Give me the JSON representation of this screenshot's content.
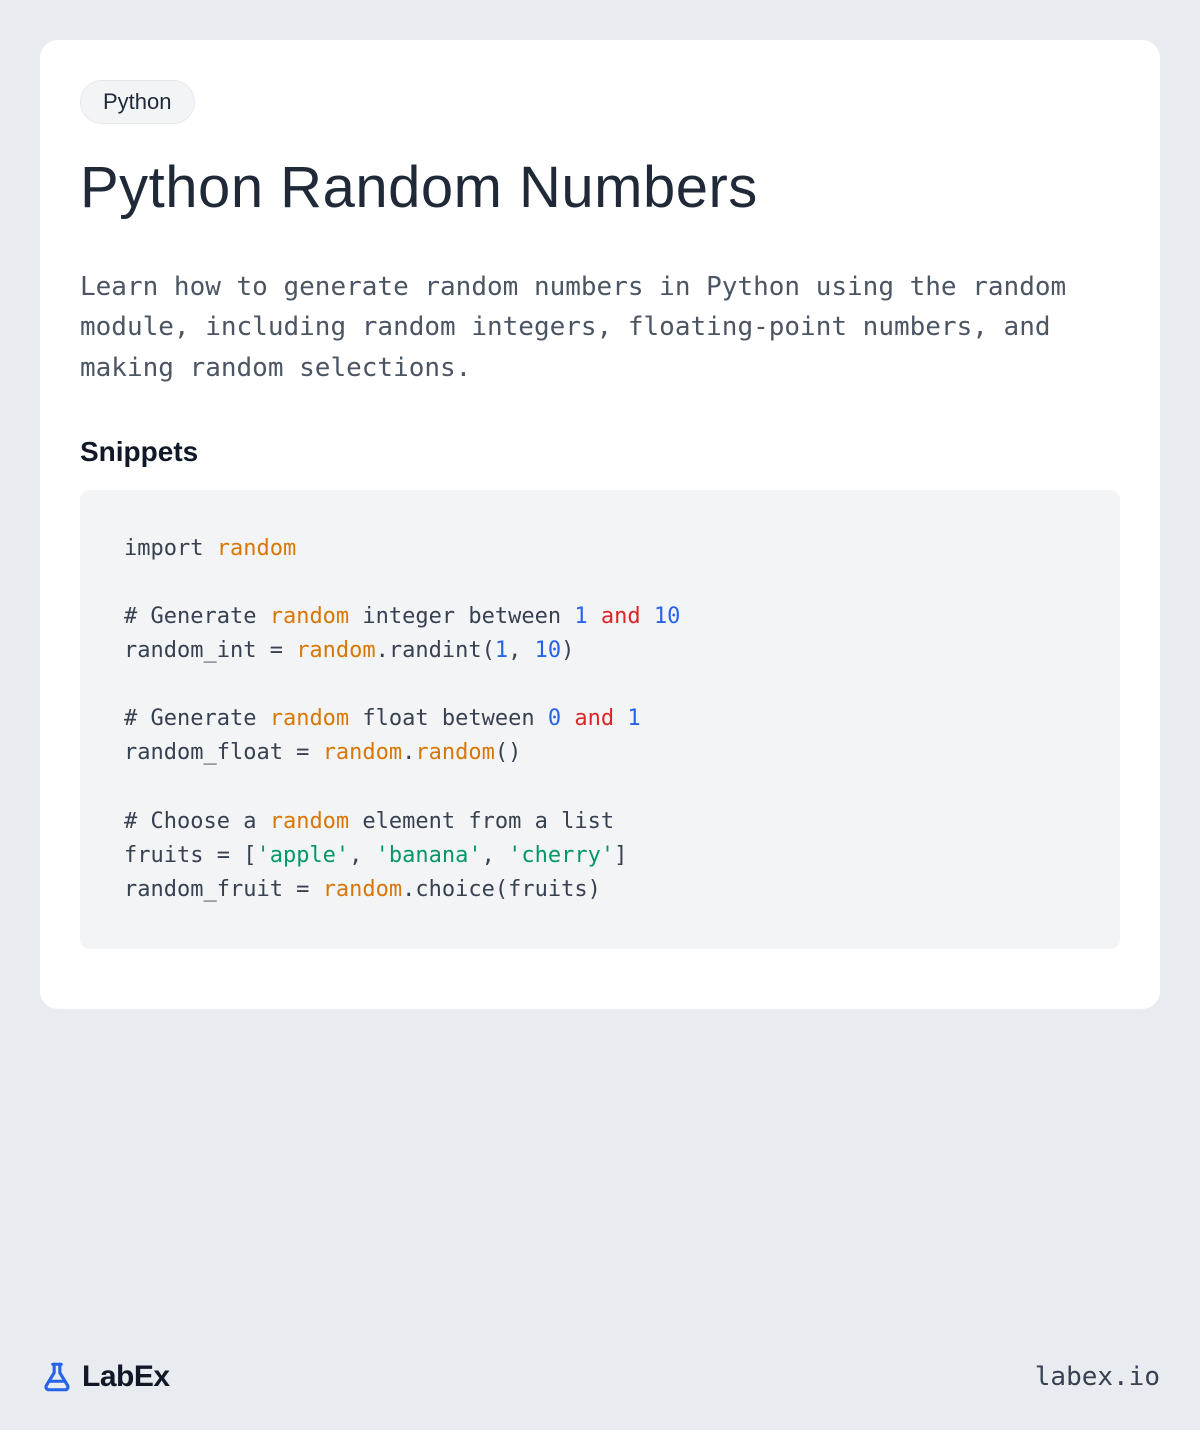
{
  "tag": "Python",
  "title": "Python Random Numbers",
  "description": "Learn how to generate random numbers in Python using the random module, including random integers, floating-point numbers, and making random selections.",
  "snippets_heading": "Snippets",
  "code_tokens": [
    {
      "t": "import ",
      "c": "default"
    },
    {
      "t": "random",
      "c": "org"
    },
    {
      "t": "\n\n",
      "c": "default"
    },
    {
      "t": "# Generate ",
      "c": "default"
    },
    {
      "t": "random",
      "c": "org"
    },
    {
      "t": " integer between ",
      "c": "default"
    },
    {
      "t": "1",
      "c": "blu"
    },
    {
      "t": " and ",
      "c": "red"
    },
    {
      "t": "10",
      "c": "blu"
    },
    {
      "t": "\n",
      "c": "default"
    },
    {
      "t": "random_int = ",
      "c": "default"
    },
    {
      "t": "random",
      "c": "org"
    },
    {
      "t": ".randint(",
      "c": "default"
    },
    {
      "t": "1",
      "c": "blu"
    },
    {
      "t": ", ",
      "c": "default"
    },
    {
      "t": "10",
      "c": "blu"
    },
    {
      "t": ")\n\n",
      "c": "default"
    },
    {
      "t": "# Generate ",
      "c": "default"
    },
    {
      "t": "random",
      "c": "org"
    },
    {
      "t": " float between ",
      "c": "default"
    },
    {
      "t": "0",
      "c": "blu"
    },
    {
      "t": " and ",
      "c": "red"
    },
    {
      "t": "1",
      "c": "blu"
    },
    {
      "t": "\n",
      "c": "default"
    },
    {
      "t": "random_float = ",
      "c": "default"
    },
    {
      "t": "random",
      "c": "org"
    },
    {
      "t": ".",
      "c": "default"
    },
    {
      "t": "random",
      "c": "org"
    },
    {
      "t": "()\n\n",
      "c": "default"
    },
    {
      "t": "# Choose a ",
      "c": "default"
    },
    {
      "t": "random",
      "c": "org"
    },
    {
      "t": " element from a list\n",
      "c": "default"
    },
    {
      "t": "fruits = [",
      "c": "default"
    },
    {
      "t": "'apple'",
      "c": "grn"
    },
    {
      "t": ", ",
      "c": "default"
    },
    {
      "t": "'banana'",
      "c": "grn"
    },
    {
      "t": ", ",
      "c": "default"
    },
    {
      "t": "'cherry'",
      "c": "grn"
    },
    {
      "t": "]\n",
      "c": "default"
    },
    {
      "t": "random_fruit = ",
      "c": "default"
    },
    {
      "t": "random",
      "c": "org"
    },
    {
      "t": ".choice(fruits)",
      "c": "default"
    }
  ],
  "brand_text": "LabEx",
  "site_url": "labex.io"
}
